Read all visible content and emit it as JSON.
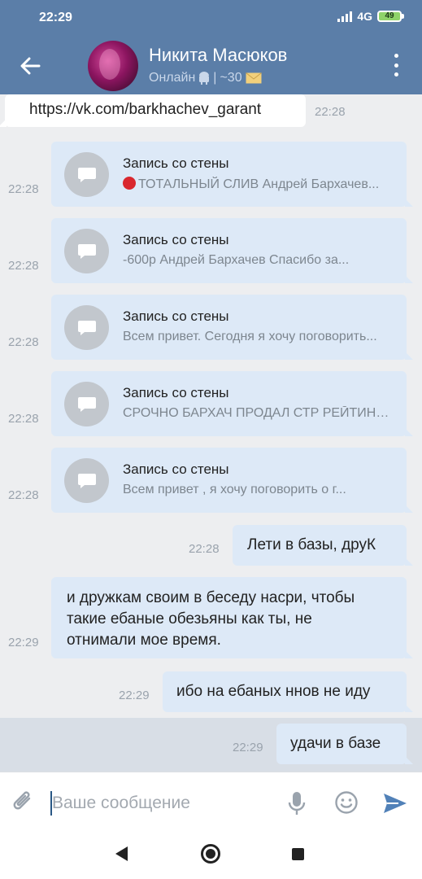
{
  "status_bar": {
    "time": "22:29",
    "network": "4G",
    "battery": "49"
  },
  "header": {
    "contact_name": "Никита Масюков",
    "status_online": "Онлайн",
    "status_separator": "|",
    "status_extra": "~30"
  },
  "messages": [
    {
      "type": "link",
      "direction": "in",
      "text": "https://vk.com/barkhachev_garant",
      "time": "22:28"
    },
    {
      "type": "wall",
      "direction": "out",
      "title": "Запись со стены",
      "snippet": "ТОТАЛЬНЫЙ СЛИВ Андрей Бархачев...",
      "has_red_dot": true,
      "time": "22:28"
    },
    {
      "type": "wall",
      "direction": "out",
      "title": "Запись со стены",
      "snippet": "-600р Андрей Бархачев  Спасибо за...",
      "time": "22:28"
    },
    {
      "type": "wall",
      "direction": "out",
      "title": "Запись со стены",
      "snippet": "Всем привет. Сегодня я хочу поговорить...",
      "time": "22:28"
    },
    {
      "type": "wall",
      "direction": "out",
      "title": "Запись со стены",
      "snippet": "СРОЧНО БАРХАЧ ПРОДАЛ СТР РЕЙТИНГ...",
      "time": "22:28"
    },
    {
      "type": "wall",
      "direction": "out",
      "title": "Запись со стены",
      "snippet": "Всем привет , я хочу поговорить о г...",
      "time": "22:28"
    },
    {
      "type": "text",
      "direction": "out",
      "text": "Лети в базы, друК",
      "time": "22:28"
    },
    {
      "type": "text",
      "direction": "out",
      "lines": [
        "и дружкам своим в беседу насри, чтобы",
        "такие ебаные обезьяны как ты, не",
        "отнимали мое время."
      ],
      "time": "22:29"
    },
    {
      "type": "text",
      "direction": "out",
      "text": "ибо на ебаных ннов не иду",
      "time": "22:29"
    },
    {
      "type": "text",
      "direction": "out",
      "text": "удачи в базе",
      "time": "22:29",
      "selected": true
    }
  ],
  "input": {
    "placeholder": "Ваше сообщение",
    "value": ""
  },
  "icons": {
    "back": "arrow-left-icon",
    "menu": "more-vertical-icon",
    "attach": "paperclip-icon",
    "mic": "microphone-icon",
    "emoji": "smiley-icon",
    "send": "send-icon",
    "wall": "comment-icon"
  },
  "colors": {
    "header": "#5b7ea8",
    "bubble_out": "#dde9f7",
    "bubble_in": "#ffffff",
    "background": "#edeef0",
    "accent": "#5181b8"
  }
}
